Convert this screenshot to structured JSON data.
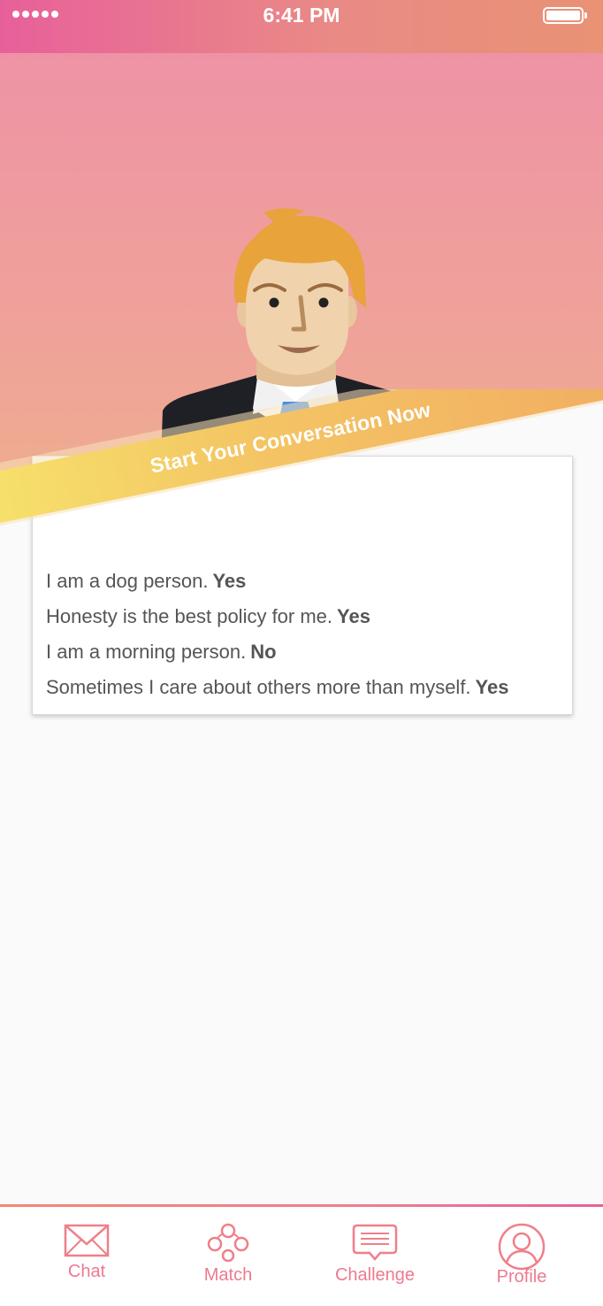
{
  "status_bar": {
    "time": "6:41 PM"
  },
  "banner": {
    "title": "Start Your Conversation Now"
  },
  "answers": [
    {
      "statement": "I am a dog person.",
      "answer": "Yes"
    },
    {
      "statement": "Honesty is the best policy for me.",
      "answer": "Yes"
    },
    {
      "statement": "I am a morning person.",
      "answer": "No"
    },
    {
      "statement": "Sometimes I care about others more than myself.",
      "answer": "Yes"
    }
  ],
  "tabs": [
    {
      "label": "Chat",
      "icon": "envelope-icon"
    },
    {
      "label": "Match",
      "icon": "match-icon"
    },
    {
      "label": "Challenge",
      "icon": "speech-bubble-icon"
    },
    {
      "label": "Profile",
      "icon": "user-icon"
    }
  ],
  "colors": {
    "accent": "#ef7f8a",
    "banner_start": "#f6e36c",
    "banner_end": "#f2ac62",
    "hero_top": "#ee93a5",
    "hero_bottom": "#efaf8d"
  }
}
